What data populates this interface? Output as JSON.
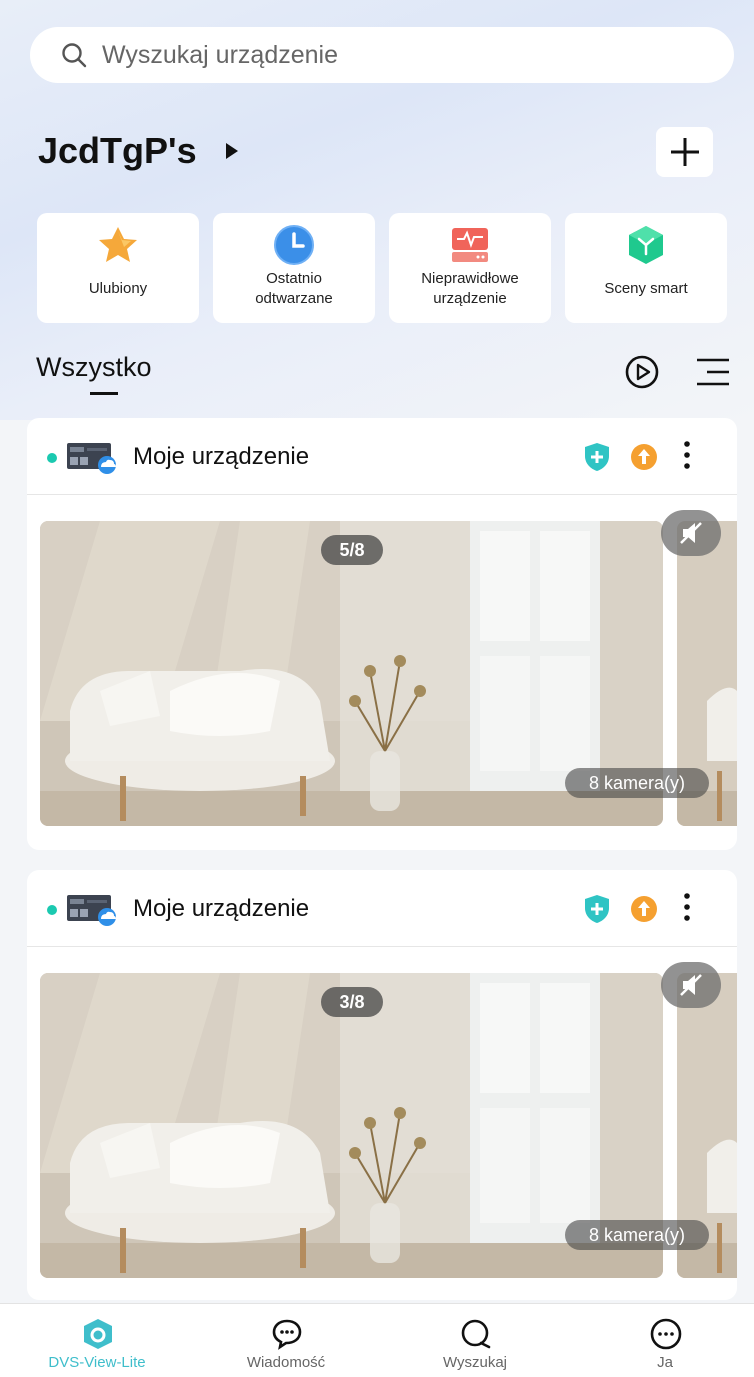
{
  "search": {
    "placeholder": "Wyszukaj urządzenie"
  },
  "home": {
    "title": "JcdTgP's"
  },
  "quick_actions": [
    {
      "label": "Ulubiony",
      "icon": "star-icon"
    },
    {
      "label": "Ostatnio\nodtwarzane",
      "icon": "clock-icon"
    },
    {
      "label": "Nieprawidłowe\nurządzenie",
      "icon": "abnormal-device-icon"
    },
    {
      "label": "Sceny smart",
      "icon": "smart-scene-icon"
    }
  ],
  "section": {
    "tab_label": "Wszystko"
  },
  "devices": [
    {
      "name": "Moje urządzenie",
      "page": "5/8",
      "camera_count": "8 kamera(y)",
      "online": true
    },
    {
      "name": "Moje urządzenie",
      "page": "3/8",
      "camera_count": "8 kamera(y)",
      "online": true
    }
  ],
  "bottom_nav": [
    {
      "label": "DVS-View-Lite",
      "icon": "home-icon",
      "active": true
    },
    {
      "label": "Wiadomość",
      "icon": "message-icon",
      "active": false
    },
    {
      "label": "Wyszukaj",
      "icon": "search-icon",
      "active": false
    },
    {
      "label": "Ja",
      "icon": "profile-icon",
      "active": false
    }
  ],
  "colors": {
    "accent": "#3fbecb",
    "online_dot": "#1bc9b0",
    "shield": "#2fc4c4",
    "update": "#f5a030"
  }
}
